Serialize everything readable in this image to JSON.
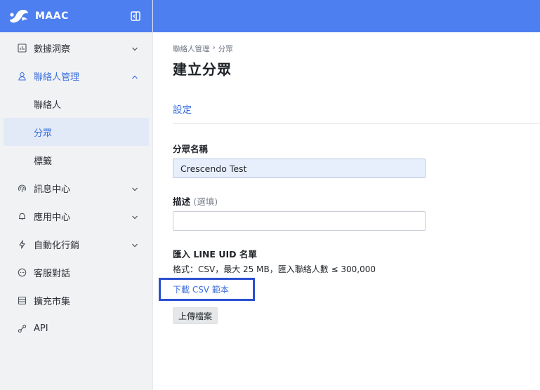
{
  "brand": {
    "name": "MAAC"
  },
  "sidebar": {
    "items": [
      {
        "label": "數據洞察",
        "icon": "chart-icon",
        "expandable": true
      },
      {
        "label": "聯絡人管理",
        "icon": "user-icon",
        "expandable": true,
        "open": true,
        "children": [
          {
            "label": "聯絡人"
          },
          {
            "label": "分眾",
            "active": true
          },
          {
            "label": "標籤"
          }
        ]
      },
      {
        "label": "訊息中心",
        "icon": "broadcast-icon",
        "expandable": true
      },
      {
        "label": "應用中心",
        "icon": "bell-icon",
        "expandable": true
      },
      {
        "label": "自動化行銷",
        "icon": "bolt-icon",
        "expandable": true
      },
      {
        "label": "客服對話",
        "icon": "chat-icon",
        "expandable": false
      },
      {
        "label": "擴充市集",
        "icon": "store-icon",
        "expandable": false
      },
      {
        "label": "API",
        "icon": "api-icon",
        "expandable": false
      }
    ]
  },
  "breadcrumb": {
    "parent": "聯絡人管理",
    "separator": "›",
    "current": "分眾"
  },
  "page": {
    "title": "建立分眾",
    "section": "設定"
  },
  "form": {
    "name_label": "分眾名稱",
    "name_value": "Crescendo Test",
    "desc_label": "描述",
    "desc_optional": "(選填)",
    "desc_value": "",
    "import_label": "匯入 LINE UID 名單",
    "format_text": "格式：CSV，最大 25 MB，匯入聯絡人數 ≤ 300,000",
    "download_link": "下載 CSV 範本",
    "upload_button": "上傳檔案"
  },
  "colors": {
    "brand": "#4d7ff0",
    "accent": "#3b6fe0",
    "highlight_box": "#2a4fd1"
  }
}
